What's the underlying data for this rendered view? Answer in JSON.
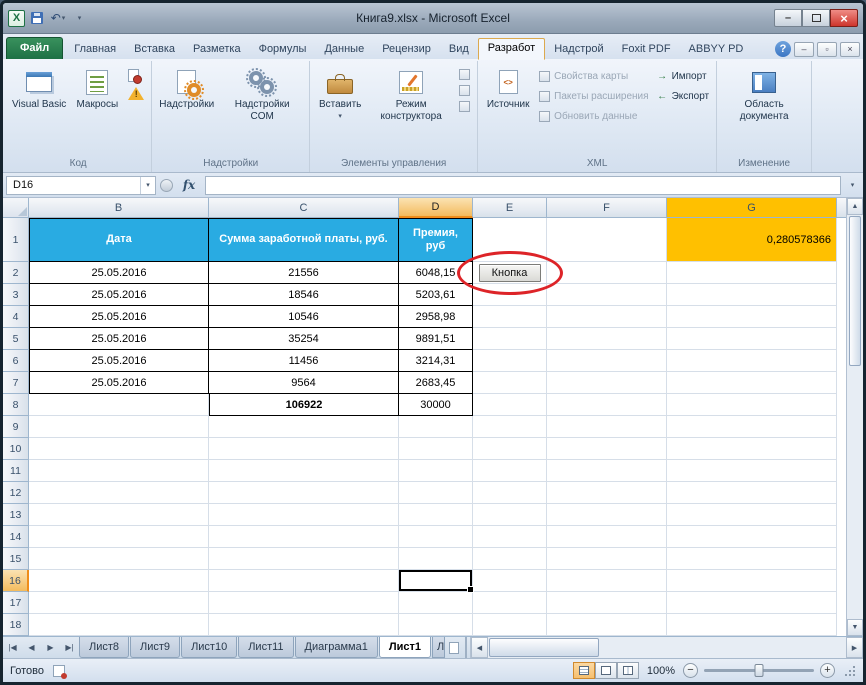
{
  "window": {
    "title": "Книга9.xlsx - Microsoft Excel"
  },
  "colors": {
    "table_header_blue": "#29ABE2",
    "highlight_orange": "#FFC000",
    "annotation_red": "#DD2428",
    "file_tab_green": "#1E7145",
    "selection_header_amber": "#F7CD85"
  },
  "ribbon": {
    "tabs": [
      {
        "label": "Файл",
        "type": "file"
      },
      {
        "label": "Главная"
      },
      {
        "label": "Вставка"
      },
      {
        "label": "Разметка"
      },
      {
        "label": "Формулы"
      },
      {
        "label": "Данные"
      },
      {
        "label": "Рецензир"
      },
      {
        "label": "Вид"
      },
      {
        "label": "Разработ",
        "active": true
      },
      {
        "label": "Надстрой"
      },
      {
        "label": "Foxit PDF"
      },
      {
        "label": "ABBYY PD"
      }
    ],
    "help_icon": "?",
    "groups": {
      "code": {
        "label": "Код",
        "visual_basic": "Visual Basic",
        "macros": "Макросы"
      },
      "addins": {
        "label": "Надстройки",
        "addins": "Надстройки",
        "com_addins": "Надстройки COM"
      },
      "controls": {
        "label": "Элементы управления",
        "insert": "Вставить",
        "design_mode": "Режим конструктора"
      },
      "xml": {
        "label": "XML",
        "source": "Источник",
        "map_properties": "Свойства карты",
        "expansion_packs": "Пакеты расширения",
        "refresh_data": "Обновить данные",
        "import": "Импорт",
        "export": "Экспорт"
      },
      "modify": {
        "label": "Изменение",
        "document_panel": "Область документа"
      }
    }
  },
  "formula_bar": {
    "name_box": "D16",
    "fx_label": "fx",
    "formula_value": ""
  },
  "sheet": {
    "columns": [
      "B",
      "C",
      "D",
      "E",
      "F",
      "G"
    ],
    "row_count": 18,
    "selection": {
      "column": "D",
      "row": 16
    },
    "table": {
      "headers": [
        "Дата",
        "Сумма заработной платы, руб.",
        "Премия, руб"
      ],
      "rows": [
        [
          "25.05.2016",
          "21556",
          "6048,15"
        ],
        [
          "25.05.2016",
          "18546",
          "5203,61"
        ],
        [
          "25.05.2016",
          "10546",
          "2958,98"
        ],
        [
          "25.05.2016",
          "35254",
          "9891,51"
        ],
        [
          "25.05.2016",
          "11456",
          "3214,31"
        ],
        [
          "25.05.2016",
          "9564",
          "2683,45"
        ]
      ],
      "totals": [
        "",
        "106922",
        "30000"
      ]
    },
    "highlight_cell": {
      "column": "G",
      "row": 1,
      "value": "0,280578366"
    },
    "button": {
      "label": "Кнопка",
      "column": "E",
      "row": 2
    }
  },
  "sheet_tabs": {
    "tabs": [
      {
        "label": "Лист8"
      },
      {
        "label": "Лист9"
      },
      {
        "label": "Лист10"
      },
      {
        "label": "Лист11"
      },
      {
        "label": "Диаграмма1"
      },
      {
        "label": "Лист1",
        "active": true
      }
    ],
    "partial": "Л"
  },
  "status": {
    "ready": "Готово",
    "zoom": "100%"
  }
}
